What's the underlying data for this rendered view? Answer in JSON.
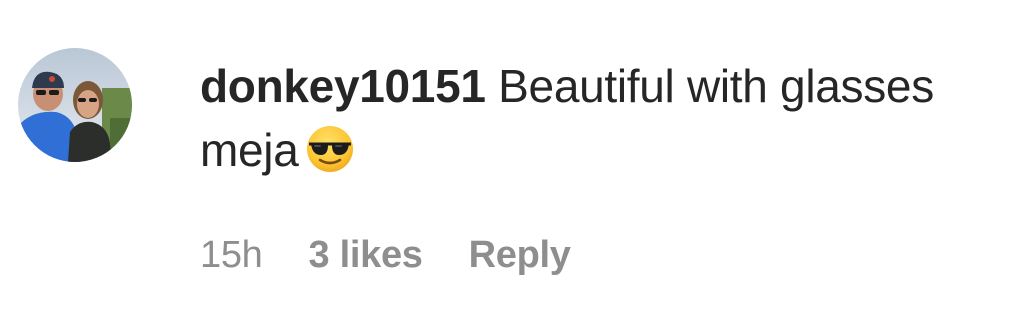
{
  "comment": {
    "username": "donkey10151",
    "text_line1": "Beautiful with glasses",
    "text_line2": "meja",
    "emoji": "sunglasses-emoji",
    "timestamp": "15h",
    "likes": "3 likes",
    "reply_label": "Reply"
  },
  "colors": {
    "text": "#262626",
    "meta": "#8e8e8e",
    "background": "#ffffff"
  }
}
